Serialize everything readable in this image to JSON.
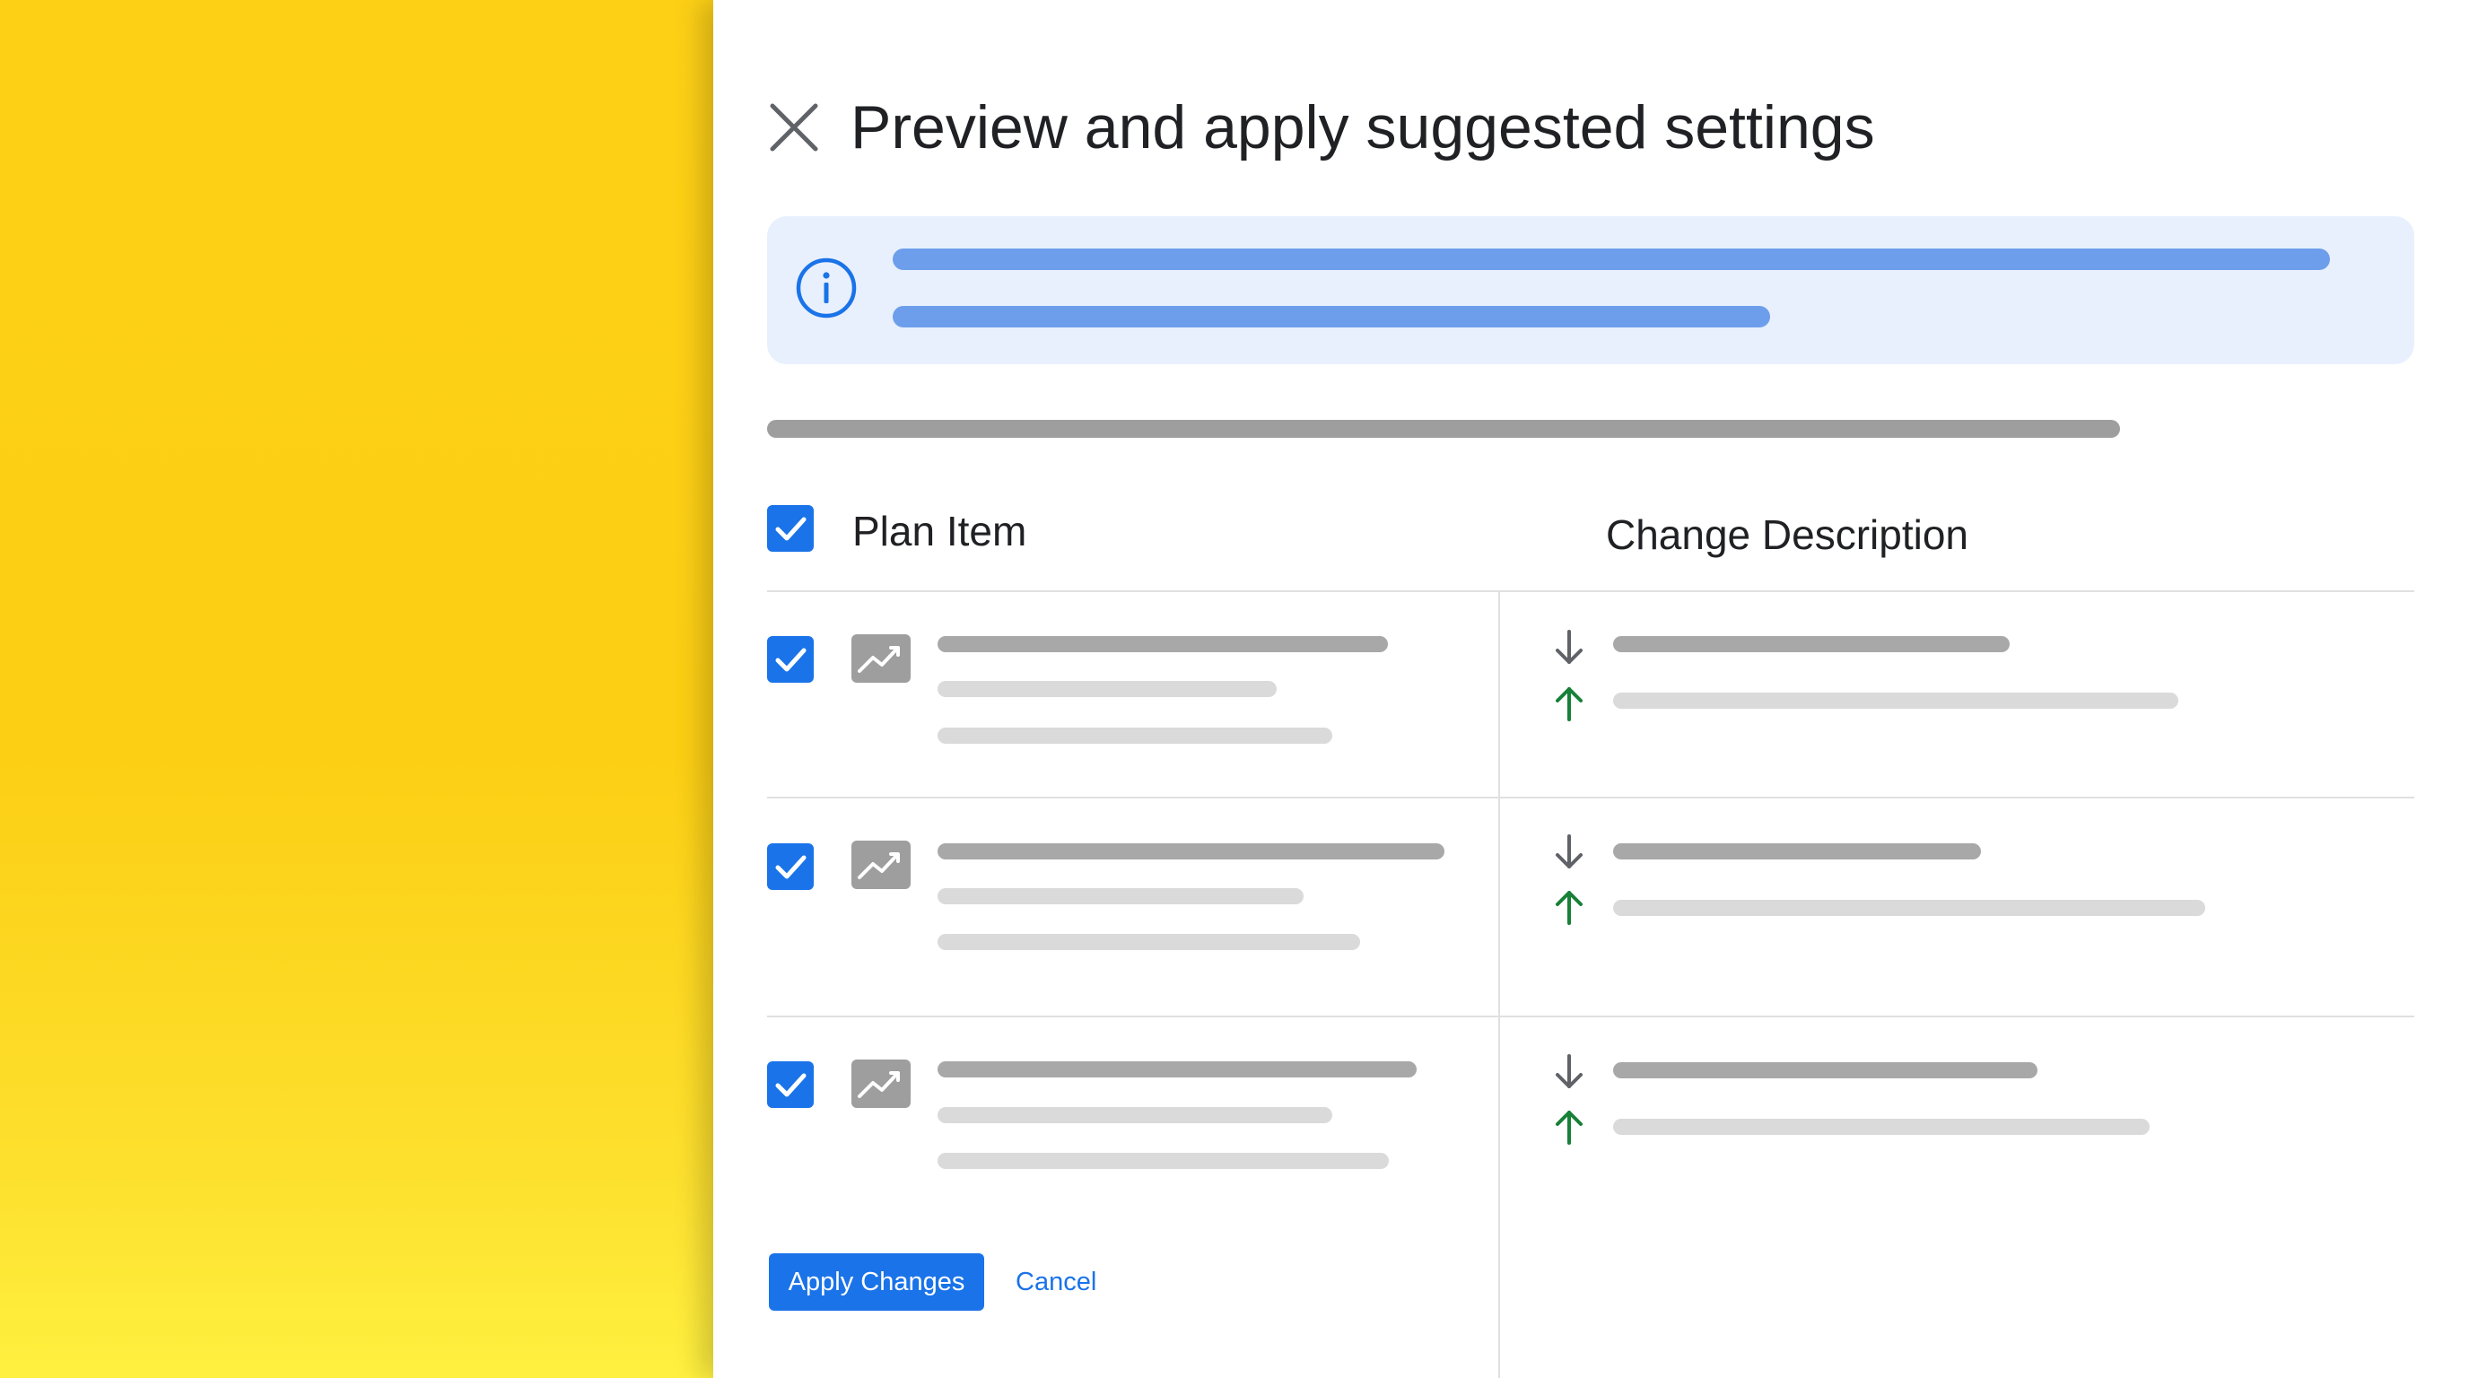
{
  "dialog": {
    "title": "Preview and apply suggested settings"
  },
  "colors": {
    "backdrop": "#fcd116",
    "accent": "#1a73e8",
    "info_banner": "#e8f0fd",
    "decrease_arrow": "#5f6368",
    "increase_arrow": "#188038"
  },
  "icons": {
    "close": "close-icon",
    "info": "info-icon",
    "plan_item": "trend-chart-icon",
    "decrease": "arrow-down-icon",
    "increase": "arrow-up-icon"
  },
  "table": {
    "select_all_checked": true,
    "headers": {
      "plan_item": "Plan Item",
      "change_description": "Change Description"
    },
    "rows": [
      {
        "checked": true
      },
      {
        "checked": true
      },
      {
        "checked": true
      }
    ]
  },
  "actions": {
    "apply_label": "Apply Changes",
    "cancel_label": "Cancel"
  }
}
